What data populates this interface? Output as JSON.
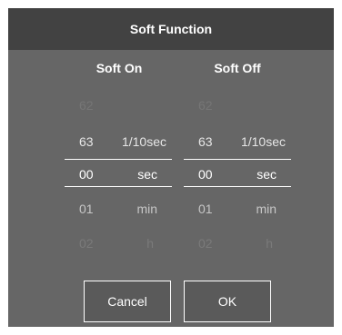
{
  "dialog": {
    "title": "Soft Function",
    "soft_on": {
      "label": "Soft On",
      "rows": [
        {
          "num": "62",
          "unit": ""
        },
        {
          "num": "63",
          "unit": "1/10sec"
        },
        {
          "num": "00",
          "unit": "sec"
        },
        {
          "num": "01",
          "unit": "min"
        },
        {
          "num": "02",
          "unit": "h"
        }
      ]
    },
    "soft_off": {
      "label": "Soft Off",
      "rows": [
        {
          "num": "62",
          "unit": ""
        },
        {
          "num": "63",
          "unit": "1/10sec"
        },
        {
          "num": "00",
          "unit": "sec"
        },
        {
          "num": "01",
          "unit": "min"
        },
        {
          "num": "02",
          "unit": "h"
        }
      ]
    },
    "buttons": {
      "cancel": "Cancel",
      "ok": "OK"
    }
  },
  "colors": {
    "dialog_bg": "#666666",
    "title_bg": "#424242",
    "text": "#ffffff"
  }
}
